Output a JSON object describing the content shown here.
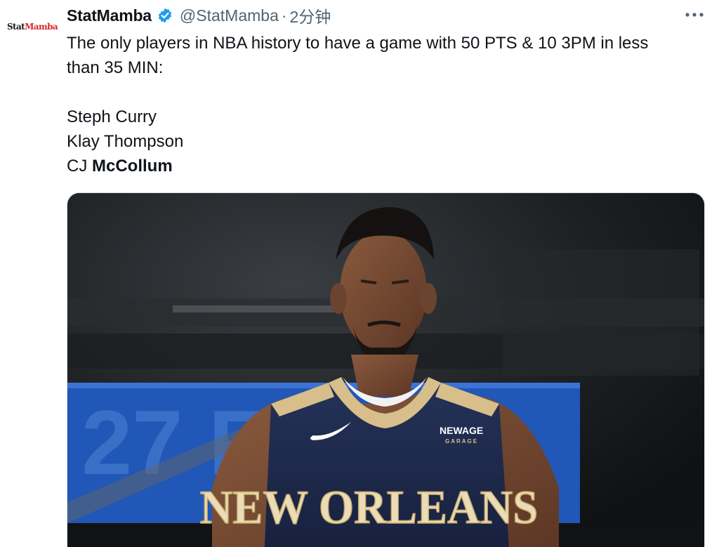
{
  "tweet": {
    "avatar": {
      "part1": "Stat",
      "part2": "Mamba"
    },
    "display_name": "StatMamba",
    "handle": "@StatMamba",
    "separator": "·",
    "timestamp": "2分钟",
    "text_line": "The only players in NBA history to have a game with 50 PTS & 10 3PM in less than 35 MIN:",
    "players": [
      "Steph Curry",
      "Klay Thompson"
    ],
    "last_player_prefix": "CJ ",
    "last_player_bold": "McCollum",
    "media": {
      "jersey_text": "NEW ORLEANS",
      "sponsor_line1": "NEWAGE",
      "sponsor_line2": "GARAGE"
    }
  },
  "icons": {
    "verified": "verified-badge-icon",
    "more": "more-options-icon"
  },
  "colors": {
    "verified_blue": "#1d9bf0",
    "jersey_navy": "#1e2a4f",
    "jersey_gold": "#d8be8a",
    "banner_blue": "#2157b6"
  }
}
